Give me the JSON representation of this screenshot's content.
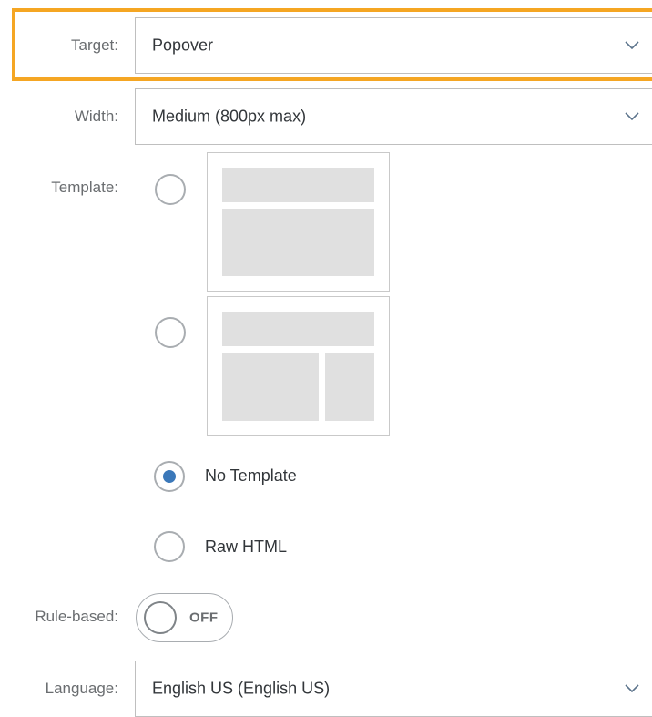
{
  "form": {
    "target": {
      "label": "Target:",
      "value": "Popover"
    },
    "width": {
      "label": "Width:",
      "value": "Medium (800px max)"
    },
    "template": {
      "label": "Template:",
      "options": [
        {
          "kind": "layout-header-body",
          "selected": false
        },
        {
          "kind": "layout-header-two-columns",
          "selected": false
        },
        {
          "kind": "text",
          "text": "No Template",
          "selected": true
        },
        {
          "kind": "text",
          "text": "Raw HTML",
          "selected": false
        }
      ]
    },
    "rule_based": {
      "label": "Rule-based:",
      "state": "OFF"
    },
    "language": {
      "label": "Language:",
      "value": "English US (English US)"
    }
  },
  "icons": {
    "dropdown": "chevron-down-icon"
  },
  "colors": {
    "highlight": "#f5a623",
    "radio_selected": "#3b78b9",
    "label": "#6a6d70",
    "text": "#32363a"
  }
}
